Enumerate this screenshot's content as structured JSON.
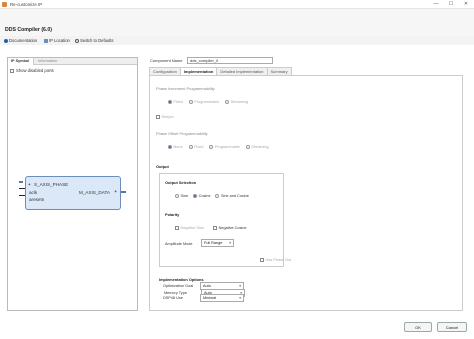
{
  "window": {
    "title": "Re-customize IP",
    "min": "—",
    "max": "☐",
    "close": "✕"
  },
  "header": {
    "title": "DDS Compiler (6.0)"
  },
  "toolbar": {
    "documentation": "Documentation",
    "ip_location": "IP Location",
    "switch_defaults": "Switch to Defaults"
  },
  "left": {
    "tabs": [
      "IP Symbol",
      "Information"
    ],
    "show_disabled": "Show disabled ports",
    "symbol": {
      "in_bus": "S_AXIS_PHASE",
      "aclk": "aclk",
      "aresetn": "aresetn",
      "out_bus": "M_AXIS_DATA"
    }
  },
  "component": {
    "label": "Component Name",
    "value": "dds_compiler_0"
  },
  "tabs": [
    "Configuration",
    "Implementation",
    "Detailed Implementation",
    "Summary"
  ],
  "phase_inc": {
    "title": "Phase Increment Programmability",
    "options": [
      "Fixed",
      "Programmable",
      "Streaming"
    ],
    "resync": "Resync"
  },
  "phase_off": {
    "title": "Phase Offset Programmability",
    "options": [
      "None",
      "Fixed",
      "Programmable",
      "Streaming"
    ]
  },
  "output": {
    "title": "Output",
    "selection_title": "Output Selection",
    "selection_options": [
      "Sine",
      "Cosine",
      "Sine and Cosine"
    ],
    "polarity_title": "Polarity",
    "negative_sine": "Negative Sine",
    "negative_cosine": "Negative Cosine",
    "amplitude_label": "Amplitude Mode",
    "amplitude_value": "Full Range"
  },
  "impl": {
    "title": "Implementation Options",
    "has_phase_out": "Has Phase Out",
    "memory_label": "Memory Type",
    "memory_value": "Auto",
    "optim_label": "Optimization Goal",
    "optim_value": "Auto",
    "dsp_label": "DSP48 Use",
    "dsp_value": "Minimal"
  },
  "buttons": {
    "ok": "OK",
    "cancel": "Cancel"
  }
}
